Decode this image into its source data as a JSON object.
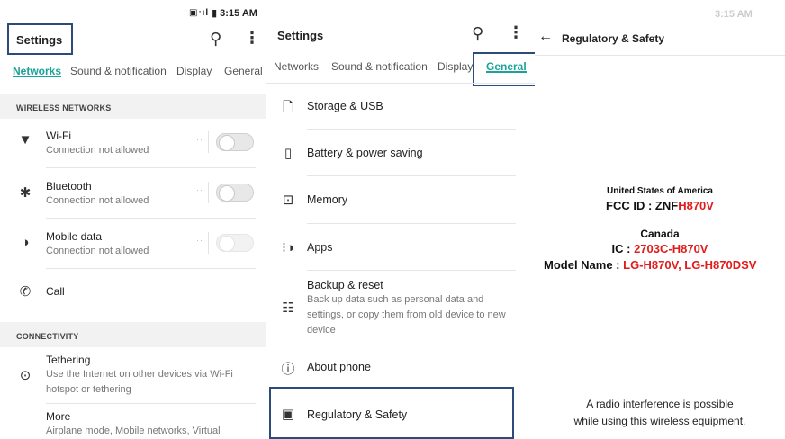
{
  "left_screen": {
    "status": {
      "icons": "▣ᐧıl",
      "battery": "▮",
      "time": "3:15 AM"
    },
    "title": "Settings",
    "tabs": [
      {
        "label": "Networks",
        "active": true
      },
      {
        "label": "Sound & notification",
        "active": false
      },
      {
        "label": "Display",
        "active": false
      },
      {
        "label": "General",
        "active": false
      }
    ],
    "sections": [
      {
        "header": "WIRELESS NETWORKS"
      },
      {
        "header": "CONNECTIVITY"
      }
    ],
    "items": [
      {
        "title": "Wi-Fi",
        "subtitle": "Connection not allowed",
        "icon": "wifi-icon"
      },
      {
        "title": "Bluetooth",
        "subtitle": "Connection not allowed",
        "icon": "bluetooth-icon"
      },
      {
        "title": "Mobile data",
        "subtitle": "Connection not allowed",
        "icon": "mobile-data-icon"
      },
      {
        "title": "Call",
        "icon": "phone-icon"
      },
      {
        "title": "Tethering",
        "subtitle": "Use the Internet on other devices via Wi-Fi hotspot or tethering",
        "icon": "tethering-icon"
      },
      {
        "title": "More",
        "subtitle": "Airplane mode, Mobile networks, Virtual",
        "icon": ""
      }
    ],
    "toggle_dots": "···"
  },
  "middle_screen": {
    "title": "Settings",
    "tabs": [
      {
        "label": "Networks",
        "active": false
      },
      {
        "label": "Sound & notification",
        "active": false
      },
      {
        "label": "Display",
        "active": false
      },
      {
        "label": "General",
        "active": true
      }
    ],
    "items": [
      {
        "title": "Storage & USB",
        "icon": "storage-icon"
      },
      {
        "title": "Battery & power saving",
        "icon": "battery-icon"
      },
      {
        "title": "Memory",
        "icon": "memory-icon"
      },
      {
        "title": "Apps",
        "icon": "apps-icon"
      },
      {
        "title": "Backup & reset",
        "subtitle": "Back up data such as personal data and settings, or copy them from old device to new device",
        "icon": "backup-icon"
      },
      {
        "title": "About phone",
        "icon": "about-phone-icon"
      },
      {
        "title": "Regulatory & Safety",
        "icon": "regulatory-icon"
      }
    ]
  },
  "right_screen": {
    "status": {
      "time": "3:15 AM"
    },
    "title": "Regulatory & Safety",
    "usa_heading": "United States of America",
    "fcc_label": "FCC ID : ZNF",
    "fcc_value": "H870V",
    "canada_heading": "Canada",
    "ic_label": "IC : ",
    "ic_value": "2703C-H870V",
    "model_label": "Model Name : ",
    "model_value": "LG-H870V, LG-H870DSV",
    "note_line1": "A radio interference is possible",
    "note_line2": "while using this wireless equipment."
  },
  "colors": {
    "accent": "#1aa39a",
    "highlight_box": "#2c4a7a",
    "model_red": "#e21b1b"
  }
}
